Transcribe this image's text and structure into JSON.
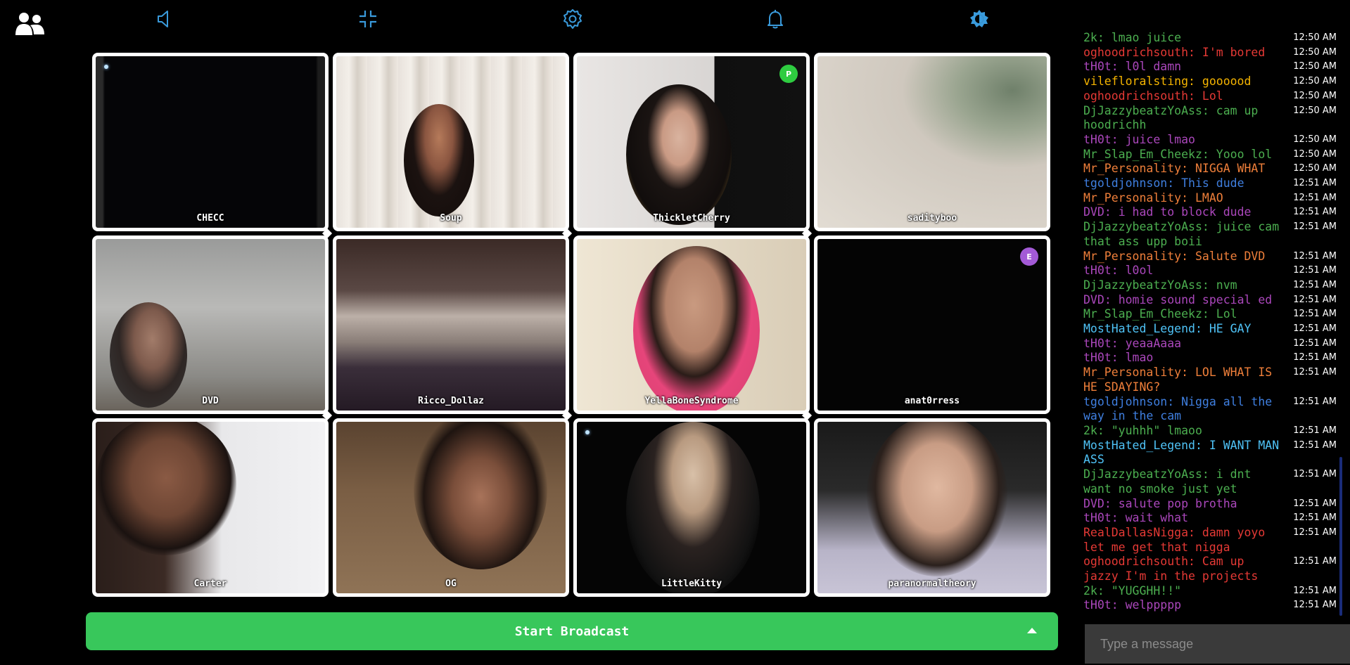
{
  "toolbar": {
    "icons": [
      "users-icon",
      "volume-icon",
      "minimize-icon",
      "settings-icon",
      "bell-icon",
      "brightness-icon"
    ],
    "accent": "#3a9bdc"
  },
  "tiles": [
    {
      "name": "CHECC",
      "badge": ""
    },
    {
      "name": "Soup",
      "badge": ""
    },
    {
      "name": "ThickletCherry",
      "badge": "P"
    },
    {
      "name": "sadityboo",
      "badge": ""
    },
    {
      "name": "DVD",
      "badge": ""
    },
    {
      "name": "Ricco_Dollaz",
      "badge": ""
    },
    {
      "name": "YellaBoneSyndrome",
      "badge": ""
    },
    {
      "name": "anat0rress",
      "badge": "E"
    },
    {
      "name": "Carter",
      "badge": ""
    },
    {
      "name": "OG",
      "badge": ""
    },
    {
      "name": "LittleKitty",
      "badge": ""
    },
    {
      "name": "paranormaltheory",
      "badge": ""
    }
  ],
  "broadcast": {
    "label": "Start Broadcast",
    "color": "#38c75b"
  },
  "chat": {
    "messages": [
      {
        "user": "2k",
        "text": "lmao juice",
        "time": "12:50 AM",
        "color": "#4caf50"
      },
      {
        "user": "oghoodrichsouth",
        "text": "I'm bored",
        "time": "12:50 AM",
        "color": "#e53935"
      },
      {
        "user": "tH0t",
        "text": "l0l damn",
        "time": "12:50 AM",
        "color": "#ab47bc"
      },
      {
        "user": "vilefloralsting",
        "text": "goooood",
        "time": "12:50 AM",
        "color": "#f5b400"
      },
      {
        "user": "oghoodrichsouth",
        "text": "Lol",
        "time": "12:50 AM",
        "color": "#e53935"
      },
      {
        "user": "DjJazzybeatzYoAss",
        "text": "cam up hoodrichh",
        "time": "12:50 AM",
        "color": "#4caf50"
      },
      {
        "user": "tH0t",
        "text": "juice lmao",
        "time": "12:50 AM",
        "color": "#ab47bc"
      },
      {
        "user": "Mr_Slap_Em_Cheekz",
        "text": "Yooo lol",
        "time": "12:50 AM",
        "color": "#4caf50"
      },
      {
        "user": "Mr_Personality",
        "text": "NIGGA WHAT",
        "time": "12:50 AM",
        "color": "#ef7f3a"
      },
      {
        "user": "tgoldjohnson",
        "text": "This dude",
        "time": "12:51 AM",
        "color": "#3f7fe0"
      },
      {
        "user": "Mr_Personality",
        "text": "LMAO",
        "time": "12:51 AM",
        "color": "#ef7f3a"
      },
      {
        "user": "DVD",
        "text": "i had to block dude",
        "time": "12:51 AM",
        "color": "#ab47bc"
      },
      {
        "user": "DjJazzybeatzYoAss",
        "text": "juice cam that ass upp boii",
        "time": "12:51 AM",
        "color": "#4caf50"
      },
      {
        "user": "Mr_Personality",
        "text": "Salute DVD",
        "time": "12:51 AM",
        "color": "#ef7f3a"
      },
      {
        "user": "tH0t",
        "text": "l0ol",
        "time": "12:51 AM",
        "color": "#ab47bc"
      },
      {
        "user": "DjJazzybeatzYoAss",
        "text": "nvm",
        "time": "12:51 AM",
        "color": "#4caf50"
      },
      {
        "user": "DVD",
        "text": "homie sound special ed",
        "time": "12:51 AM",
        "color": "#ab47bc"
      },
      {
        "user": "Mr_Slap_Em_Cheekz",
        "text": "Lol",
        "time": "12:51 AM",
        "color": "#4caf50"
      },
      {
        "user": "MostHated_Legend",
        "text": "HE GAY",
        "time": "12:51 AM",
        "color": "#4fc3f7"
      },
      {
        "user": "tH0t",
        "text": "yeaaAaaa",
        "time": "12:51 AM",
        "color": "#ab47bc"
      },
      {
        "user": "tH0t",
        "text": "lmao",
        "time": "12:51 AM",
        "color": "#ab47bc"
      },
      {
        "user": "Mr_Personality",
        "text": "LOL WHAT IS HE SDAYING?",
        "time": "12:51 AM",
        "color": "#ef7f3a"
      },
      {
        "user": "tgoldjohnson",
        "text": "Nigga all the way in the cam",
        "time": "12:51 AM",
        "color": "#3f7fe0"
      },
      {
        "user": "2k",
        "text": "\"yuhhh\" lmaoo",
        "time": "12:51 AM",
        "color": "#4caf50"
      },
      {
        "user": "MostHated_Legend",
        "text": "I WANT MAN ASS",
        "time": "12:51 AM",
        "color": "#4fc3f7"
      },
      {
        "user": "DjJazzybeatzYoAss",
        "text": "i dnt want no smoke just yet",
        "time": "12:51 AM",
        "color": "#4caf50"
      },
      {
        "user": "DVD",
        "text": "salute pop brotha",
        "time": "12:51 AM",
        "color": "#ab47bc"
      },
      {
        "user": "tH0t",
        "text": "wait what",
        "time": "12:51 AM",
        "color": "#ab47bc"
      },
      {
        "user": "RealDallasNigga",
        "text": "damn yoyo let me get that nigga",
        "time": "12:51 AM",
        "color": "#e53935"
      },
      {
        "user": "oghoodrichsouth",
        "text": "Cam up jazzy I'm in the projects",
        "time": "12:51 AM",
        "color": "#e53935"
      },
      {
        "user": "2k",
        "text": "\"YUGGHH!!\"",
        "time": "12:51 AM",
        "color": "#4caf50"
      },
      {
        "user": "tH0t",
        "text": "welppppp",
        "time": "12:51 AM",
        "color": "#ab47bc"
      }
    ],
    "input_placeholder": "Type a message"
  }
}
